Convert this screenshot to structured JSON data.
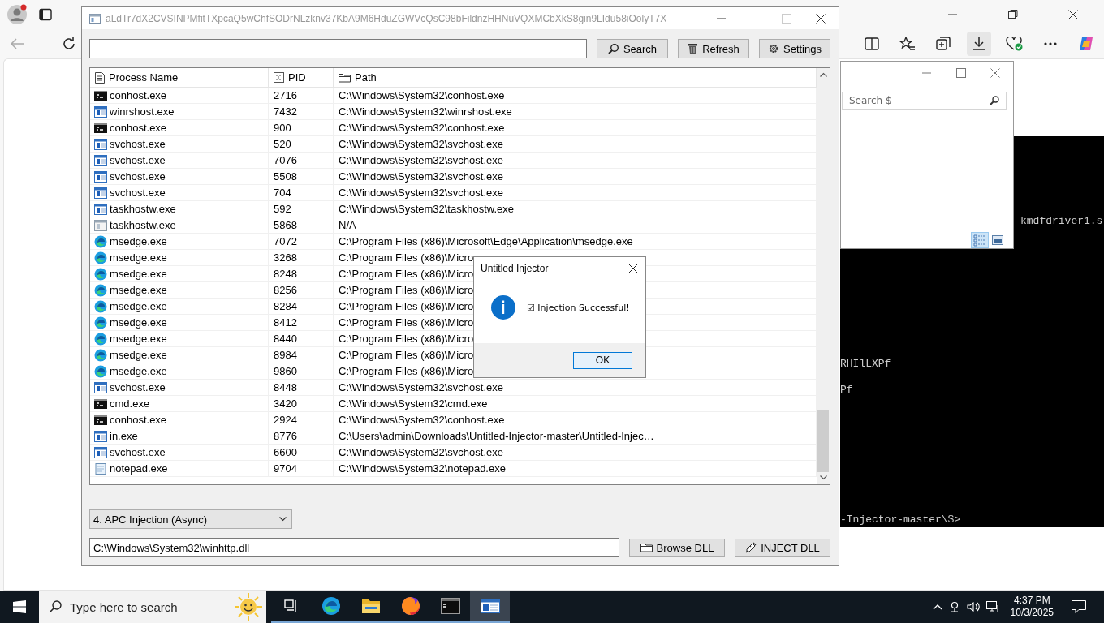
{
  "search_popup": {
    "placeholder": "Search $"
  },
  "console": {
    "lines": [
      "kmdfdriver1.s",
      "RHIlLXPf",
      "Pf",
      "-Injector-master\\$>"
    ]
  },
  "injector": {
    "title": "aLdTr7dX2CVSINPMfitTXpcaQ5wChfSODrNLzknv37KbA9M6HduZGWVcQsC98bFildnzHHNuVQXMCbXkS8gin9LIdu58iOolyT7X",
    "toolbar": [
      {
        "label": "Search",
        "kind": "search"
      },
      {
        "label": "Refresh",
        "kind": "bin"
      },
      {
        "label": "Settings",
        "kind": "gear"
      }
    ],
    "table": {
      "columns": [
        {
          "label": "Process Name",
          "kind": "doc"
        },
        {
          "label": "PID",
          "kind": "grid"
        },
        {
          "label": "Path",
          "kind": "folder"
        }
      ],
      "rows": [
        {
          "kind": "console",
          "name": "conhost.exe",
          "pid": "2716",
          "path": "C:\\Windows\\System32\\conhost.exe"
        },
        {
          "kind": "app",
          "name": "winrshost.exe",
          "pid": "7432",
          "path": "C:\\Windows\\System32\\winrshost.exe"
        },
        {
          "kind": "console",
          "name": "conhost.exe",
          "pid": "900",
          "path": "C:\\Windows\\System32\\conhost.exe"
        },
        {
          "kind": "app",
          "name": "svchost.exe",
          "pid": "520",
          "path": "C:\\Windows\\System32\\svchost.exe"
        },
        {
          "kind": "app",
          "name": "svchost.exe",
          "pid": "7076",
          "path": "C:\\Windows\\System32\\svchost.exe"
        },
        {
          "kind": "app",
          "name": "svchost.exe",
          "pid": "5508",
          "path": "C:\\Windows\\System32\\svchost.exe"
        },
        {
          "kind": "app",
          "name": "svchost.exe",
          "pid": "704",
          "path": "C:\\Windows\\System32\\svchost.exe"
        },
        {
          "kind": "app",
          "name": "taskhostw.exe",
          "pid": "592",
          "path": "C:\\Windows\\System32\\taskhostw.exe"
        },
        {
          "kind": "blank",
          "name": "taskhostw.exe",
          "pid": "5868",
          "path": "N/A"
        },
        {
          "kind": "edge",
          "name": "msedge.exe",
          "pid": "7072",
          "path": "C:\\Program Files (x86)\\Microsoft\\Edge\\Application\\msedge.exe"
        },
        {
          "kind": "edge",
          "name": "msedge.exe",
          "pid": "3268",
          "path": "C:\\Program Files (x86)\\Micro"
        },
        {
          "kind": "edge",
          "name": "msedge.exe",
          "pid": "8248",
          "path": "C:\\Program Files (x86)\\Micro"
        },
        {
          "kind": "edge",
          "name": "msedge.exe",
          "pid": "8256",
          "path": "C:\\Program Files (x86)\\Micro"
        },
        {
          "kind": "edge",
          "name": "msedge.exe",
          "pid": "8284",
          "path": "C:\\Program Files (x86)\\Micro"
        },
        {
          "kind": "edge",
          "name": "msedge.exe",
          "pid": "8412",
          "path": "C:\\Program Files (x86)\\Micro"
        },
        {
          "kind": "edge",
          "name": "msedge.exe",
          "pid": "8440",
          "path": "C:\\Program Files (x86)\\Micro"
        },
        {
          "kind": "edge",
          "name": "msedge.exe",
          "pid": "8984",
          "path": "C:\\Program Files (x86)\\Micro"
        },
        {
          "kind": "edge",
          "name": "msedge.exe",
          "pid": "9860",
          "path": "C:\\Program Files (x86)\\Micro"
        },
        {
          "kind": "app",
          "name": "svchost.exe",
          "pid": "8448",
          "path": "C:\\Windows\\System32\\svchost.exe"
        },
        {
          "kind": "console",
          "name": "cmd.exe",
          "pid": "3420",
          "path": "C:\\Windows\\System32\\cmd.exe"
        },
        {
          "kind": "console",
          "name": "conhost.exe",
          "pid": "2924",
          "path": "C:\\Windows\\System32\\conhost.exe"
        },
        {
          "kind": "app",
          "name": "in.exe",
          "pid": "8776",
          "path": "C:\\Users\\admin\\Downloads\\Untitled-Injector-master\\Untitled-Injec…"
        },
        {
          "kind": "app",
          "name": "svchost.exe",
          "pid": "6600",
          "path": "C:\\Windows\\System32\\svchost.exe"
        },
        {
          "kind": "notepad",
          "name": "notepad.exe",
          "pid": "9704",
          "path": "C:\\Windows\\System32\\notepad.exe"
        }
      ]
    },
    "method": {
      "value": "4. APC Injection (Async)"
    },
    "dll_path": {
      "value": "C:\\Windows\\System32\\winhttp.dll"
    },
    "actions": [
      {
        "label": "Browse DLL",
        "kind": "folder"
      },
      {
        "label": "INJECT DLL",
        "kind": "syringe"
      }
    ]
  },
  "dialog": {
    "title": "Untitled Injector",
    "message": "☑ Injection Successful!",
    "button": "OK"
  },
  "taskbar": {
    "search_placeholder": "Type here to search",
    "apps": [
      {
        "kind": "taskview",
        "active": false
      },
      {
        "kind": "edge",
        "active": false
      },
      {
        "kind": "folder",
        "active": false
      },
      {
        "kind": "firefox",
        "active": false
      },
      {
        "kind": "terminal",
        "active": false
      },
      {
        "kind": "window",
        "active": true
      }
    ],
    "time": "4:37 PM",
    "date": "10/3/2025"
  }
}
